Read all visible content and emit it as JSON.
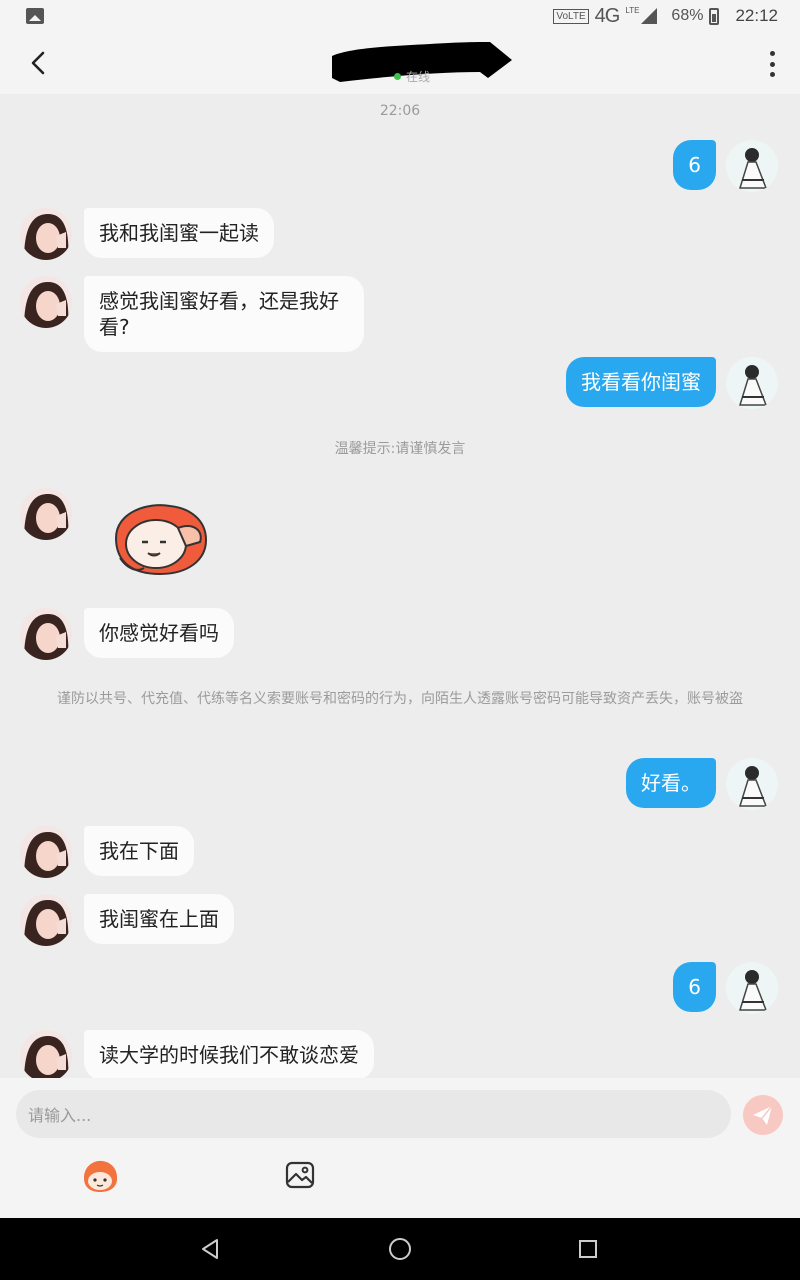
{
  "status_bar": {
    "volte": "VoLTE",
    "network": "4G",
    "lte": "LTE",
    "battery": "68%",
    "time": "22:12"
  },
  "header": {
    "online_status": "在线"
  },
  "chat": {
    "timestamp": "22:06",
    "messages": [
      {
        "side": "right",
        "text": "6"
      },
      {
        "side": "left",
        "text": "我和我闺蜜一起读"
      },
      {
        "side": "left",
        "text": "感觉我闺蜜好看，还是我好看?"
      },
      {
        "side": "right",
        "text": "我看看你闺蜜"
      },
      {
        "side": "left",
        "text": "你感觉好看吗"
      },
      {
        "side": "right",
        "text": "好看。"
      },
      {
        "side": "left",
        "text": "我在下面"
      },
      {
        "side": "left",
        "text": "我闺蜜在上面"
      },
      {
        "side": "right",
        "text": "6"
      },
      {
        "side": "left",
        "text": "读大学的时候我们不敢谈恋爱"
      }
    ],
    "tip": "温馨提示:请谨慎发言",
    "warning": "谨防以共号、代充值、代练等名义索要账号和密码的行为，向陌生人透露账号密码可能导致资产丢失，账号被盗"
  },
  "input": {
    "placeholder": "请输入..."
  },
  "colors": {
    "bubble_right": "#29a8f0",
    "bubble_left": "#fbfbfb",
    "background": "#ededed",
    "online_dot": "#3ec14b"
  }
}
